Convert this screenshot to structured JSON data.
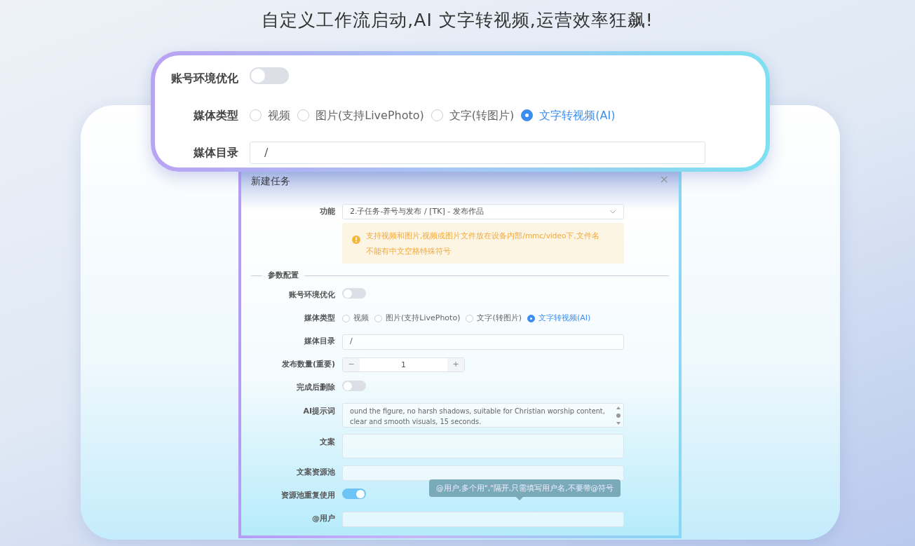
{
  "headline": "自定义工作流启动,AI 文字转视频,运营效率狂飙!",
  "callout": {
    "fields": [
      {
        "kind": "switch",
        "label": "账号环境优化",
        "on": false
      },
      {
        "kind": "radio",
        "label": "媒体类型",
        "options": [
          {
            "label": "视频",
            "selected": false
          },
          {
            "label": "图片(支持LivePhoto)",
            "selected": false
          },
          {
            "label": "文字(转图片)",
            "selected": false
          },
          {
            "label": "文字转视频(AI)",
            "selected": true
          }
        ]
      },
      {
        "kind": "input",
        "label": "媒体目录",
        "value": "/"
      }
    ]
  },
  "dialog": {
    "title": "新建任务",
    "close": "×",
    "function": {
      "label": "功能",
      "value": "2.子任务-养号与发布 / [TK] - 发布作品"
    },
    "alert": "支持视频和图片,视频或图片文件放在设备内部/mmc/video下,文件名不能有中文空格特殊符号",
    "section": "参数配置",
    "fields": [
      {
        "kind": "switch",
        "label": "账号环境优化",
        "on": false
      },
      {
        "kind": "radio",
        "label": "媒体类型",
        "options": [
          {
            "label": "视频",
            "selected": false
          },
          {
            "label": "图片(支持LivePhoto)",
            "selected": false
          },
          {
            "label": "文字(转图片)",
            "selected": false
          },
          {
            "label": "文字转视频(AI)",
            "selected": true
          }
        ]
      },
      {
        "kind": "input",
        "label": "媒体目录",
        "value": "/"
      },
      {
        "kind": "number",
        "label": "发布数量(重要)",
        "value": "1",
        "minus": "−",
        "plus": "+"
      },
      {
        "kind": "switch",
        "label": "完成后删除",
        "on": false
      },
      {
        "kind": "textarea",
        "label": "AI提示词",
        "value": "ound the figure, no harsh shadows, suitable for Christian worship content, clear and smooth visuals, 15 seconds."
      },
      {
        "kind": "textarea",
        "label": "文案"
      },
      {
        "kind": "input",
        "label": "文案资源池"
      },
      {
        "kind": "switch",
        "label": "资源池重复使用",
        "on": true
      },
      {
        "kind": "input",
        "label": "@用户",
        "tooltip": "@用户,多个用\",\"隔开,只需填写用户名,不要带@符号"
      }
    ]
  }
}
